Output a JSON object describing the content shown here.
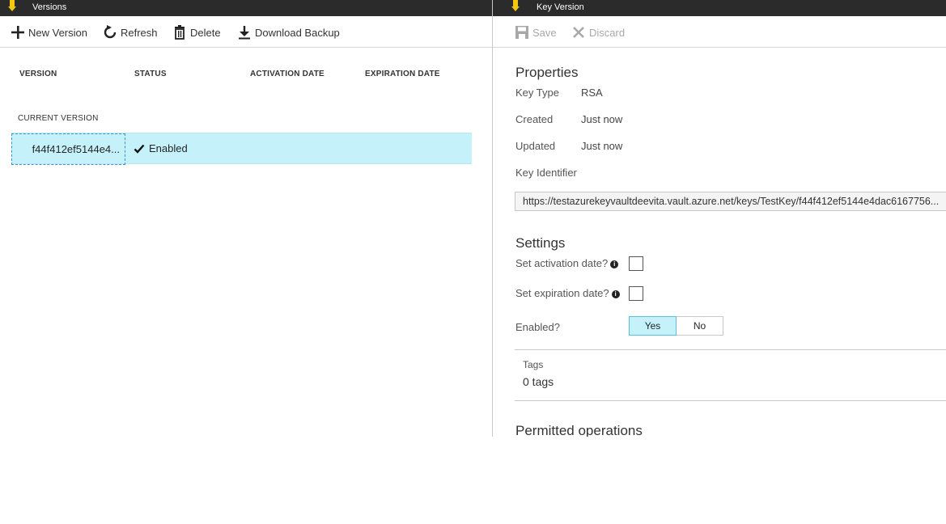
{
  "left_blade": {
    "title": "Versions",
    "toolbar": {
      "new_version": "New Version",
      "refresh": "Refresh",
      "delete": "Delete",
      "download_backup": "Download Backup"
    },
    "columns": [
      "VERSION",
      "STATUS",
      "ACTIVATION DATE",
      "EXPIRATION DATE"
    ],
    "group_label": "CURRENT VERSION",
    "rows": [
      {
        "version": "f44f412ef5144e4...",
        "status": "Enabled"
      }
    ]
  },
  "right_blade": {
    "title": "Key Version",
    "toolbar": {
      "save": "Save",
      "discard": "Discard"
    },
    "properties": {
      "title": "Properties",
      "key_type_label": "Key Type",
      "key_type_value": "RSA",
      "created_label": "Created",
      "created_value": "Just now",
      "updated_label": "Updated",
      "updated_value": "Just now",
      "key_identifier_label": "Key Identifier",
      "key_identifier_value": "https://testazurekeyvaultdeevita.vault.azure.net/keys/TestKey/f44f412ef5144e4dac6167756..."
    },
    "settings": {
      "title": "Settings",
      "activation_label": "Set activation date?",
      "expiration_label": "Set expiration date?",
      "enabled_label": "Enabled?",
      "enabled_yes": "Yes",
      "enabled_no": "No",
      "enabled_selected": "Yes"
    },
    "tags": {
      "label": "Tags",
      "value": "0 tags"
    },
    "permitted_operations": {
      "title": "Permitted operations"
    }
  },
  "colors": {
    "titlebar": "#2b2b2b",
    "pin": "#f2c811",
    "selected_row": "#c5f1fb",
    "focus_border": "#3a93c7"
  }
}
